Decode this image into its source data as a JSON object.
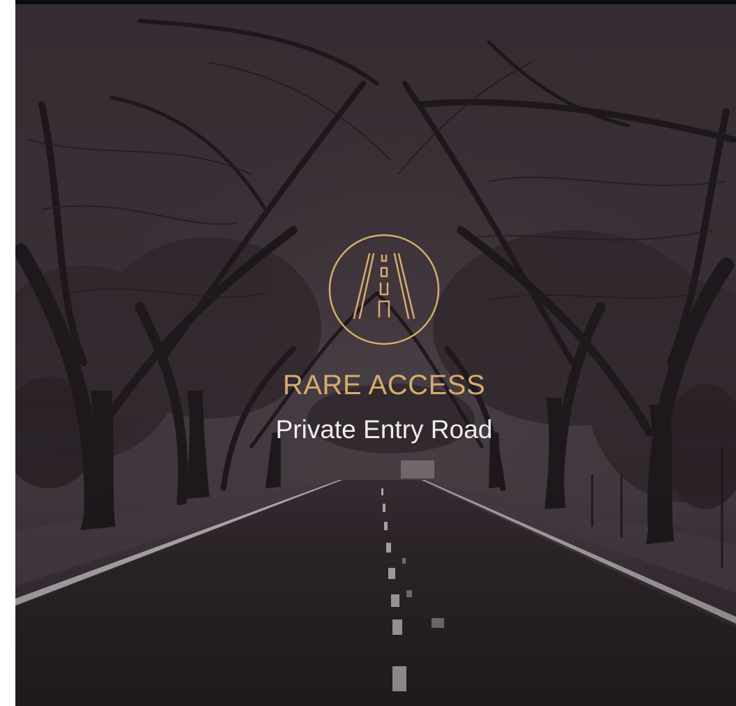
{
  "feature": {
    "icon": "road-icon",
    "headline": "RARE ACCESS",
    "subline": "Private Entry Road"
  },
  "colors": {
    "accent_gold": "#d4ad6a",
    "text_light": "#f2eef0",
    "overlay_tint": "#2a2128"
  }
}
